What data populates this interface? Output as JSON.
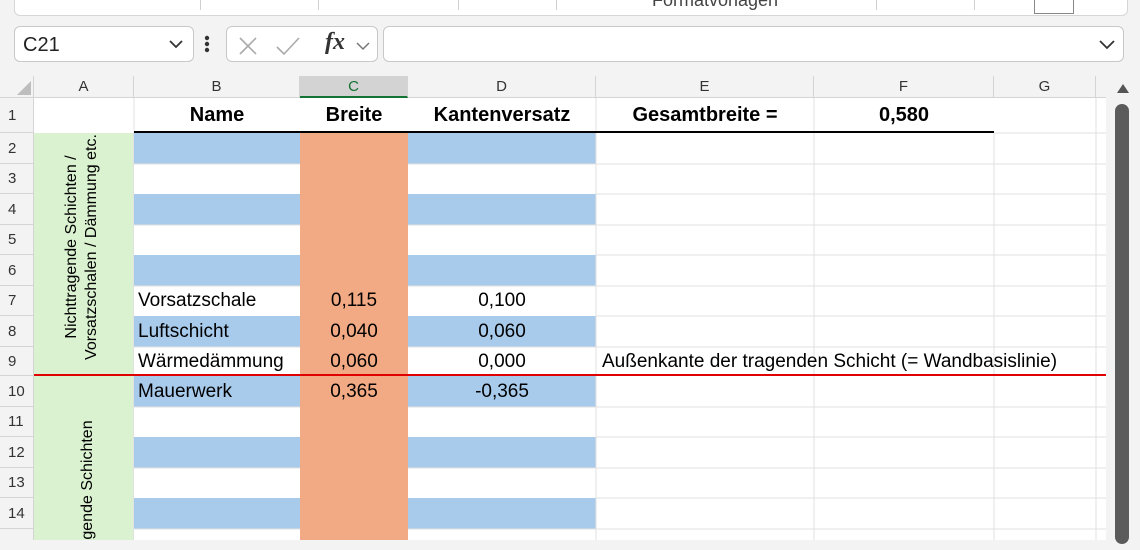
{
  "ribbon": {
    "partial_label": "Formatvorlagen"
  },
  "formula_bar": {
    "name_box": "C21",
    "fx_label": "fx",
    "formula": ""
  },
  "columns": [
    "A",
    "B",
    "C",
    "D",
    "E",
    "F",
    "G"
  ],
  "selected_column": "C",
  "rows": [
    "1",
    "2",
    "3",
    "4",
    "5",
    "6",
    "7",
    "8",
    "9",
    "10",
    "11",
    "12",
    "13",
    "14"
  ],
  "header_row": {
    "B": "Name",
    "C": "Breite",
    "D": "Kantenversatz",
    "E": "Gesamtbreite =",
    "F": "0,580"
  },
  "group_labels": {
    "nontrag_line1": "Nichttragende Schichten /",
    "nontrag_line2": "Vorsatzschalen / Dämmung etc.",
    "trag": "gende Schichten"
  },
  "data_rows": [
    {
      "row": "7",
      "name": "Vorsatzschale",
      "breite": "0,115",
      "kantenversatz": "0,100",
      "note": ""
    },
    {
      "row": "8",
      "name": "Luftschicht",
      "breite": "0,040",
      "kantenversatz": "0,060",
      "note": ""
    },
    {
      "row": "9",
      "name": "Wärmedämmung",
      "breite": "0,060",
      "kantenversatz": "0,000",
      "note": "Außenkante der tragenden Schicht (= Wandbasislinie)"
    },
    {
      "row": "10",
      "name": "Mauerwerk",
      "breite": "0,365",
      "kantenversatz": "-0,365",
      "note": ""
    }
  ],
  "colors": {
    "blue_band": "#a8caeb",
    "orange_band": "#f2aa84",
    "green_band": "#daf2d0",
    "red_line": "#e00000",
    "selected_header": "#137333"
  }
}
